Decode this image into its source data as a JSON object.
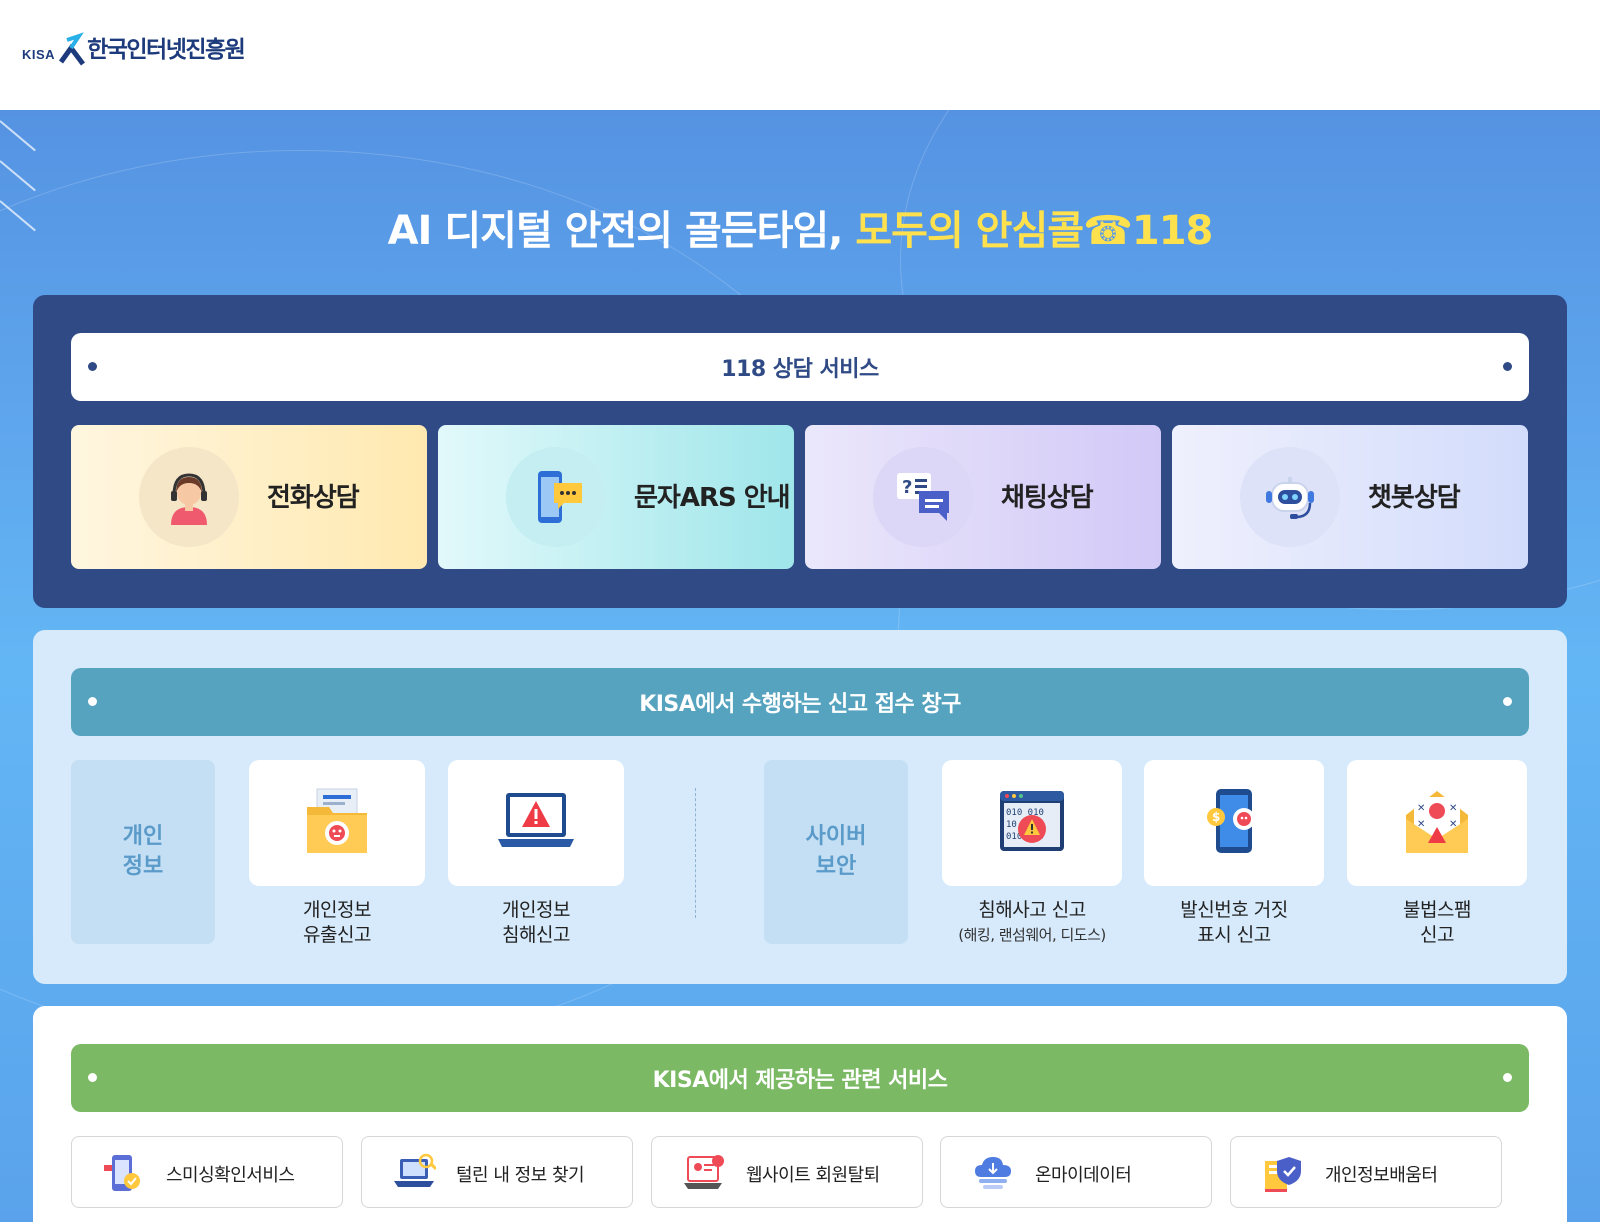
{
  "header": {
    "logo_abbr": "KISA",
    "logo_name": "한국인터넷진흥원",
    "brand_color": "#1d3b7c"
  },
  "hero": {
    "title_main": "AI 디지털 안전의 골든타임, ",
    "title_highlight": "모두의 안심콜☎118"
  },
  "consult": {
    "title": "118 상담 서비스",
    "items": [
      {
        "label": "전화상담",
        "icon": "headset-agent-icon"
      },
      {
        "label": "문자ARS 안내",
        "icon": "phone-message-icon"
      },
      {
        "label": "채팅상담",
        "icon": "chat-bubbles-icon"
      },
      {
        "label": "챗봇상담",
        "icon": "chatbot-robot-icon"
      }
    ]
  },
  "report": {
    "title": "KISA에서 수행하는 신고 접수 창구",
    "cat_personal": "개인\n정보",
    "cat_cyber": "사이버\n보안",
    "items": [
      {
        "line1": "개인정보",
        "line2": "유출신고",
        "icon": "folder-leak-icon"
      },
      {
        "line1": "개인정보",
        "line2": "침해신고",
        "icon": "laptop-warning-icon"
      },
      {
        "line1": "침해사고 신고",
        "line2": "(해킹, 랜섬웨어, 디도스)",
        "icon": "binary-alert-icon"
      },
      {
        "line1": "발신번호 거짓",
        "line2": "표시 신고",
        "icon": "phone-caller-icon"
      },
      {
        "line1": "불법스팸",
        "line2": "신고",
        "icon": "spam-mail-icon"
      }
    ]
  },
  "services": {
    "title": "KISA에서 제공하는 관련 서비스",
    "items": [
      {
        "label": "스미싱확인서비스",
        "icon": "smishing-check-icon"
      },
      {
        "label": "털린 내 정보 찾기",
        "icon": "laptop-search-icon"
      },
      {
        "label": "웹사이트 회원탈퇴",
        "icon": "website-withdraw-icon"
      },
      {
        "label": "온마이데이터",
        "icon": "cloud-data-icon"
      },
      {
        "label": "개인정보배움터",
        "icon": "privacy-learning-icon"
      }
    ]
  },
  "colors": {
    "dark_panel": "#2f4a85",
    "teal_bar": "#56a3bf",
    "green_bar": "#7cb964",
    "highlight": "#ffe14d"
  }
}
